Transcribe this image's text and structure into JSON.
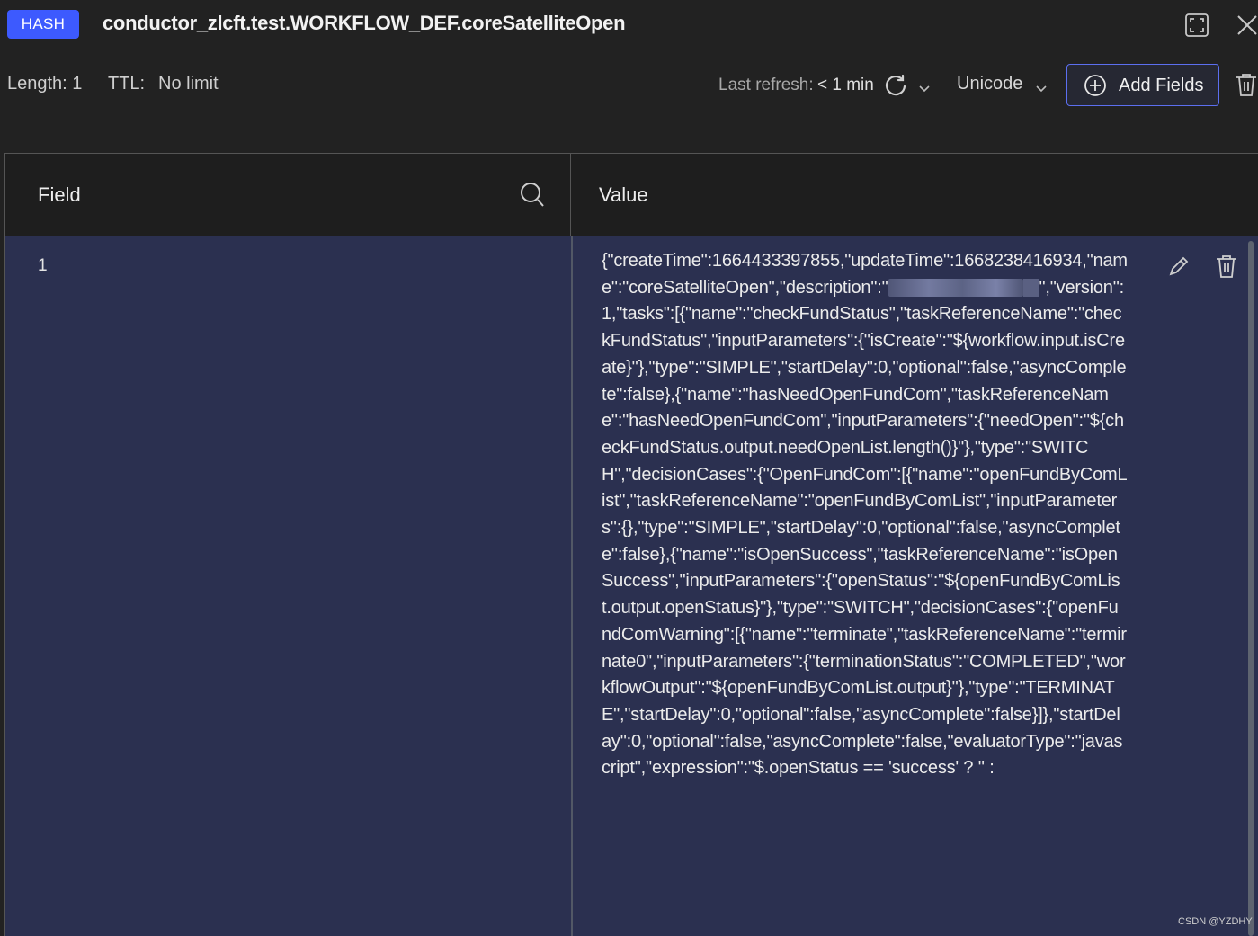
{
  "header": {
    "type_badge": "HASH",
    "key_name": "conductor_zlcft.test.WORKFLOW_DEF.coreSatelliteOpen",
    "length_label": "Length: 1",
    "ttl_label": "TTL:",
    "ttl_value": "No limit",
    "last_refresh_label": "Last refresh:",
    "last_refresh_value": "< 1 min",
    "encoding": "Unicode",
    "add_fields_label": "Add Fields"
  },
  "table": {
    "columns": [
      "Field",
      "Value"
    ],
    "rows": [
      {
        "field": "1",
        "value_part1": "{\"createTime\":1664433397855,\"updateTime\":1668238416934,\"name\":\"coreSatelliteOpen\",\"description\":\"",
        "value_part2": "\",\"version\":1,\"tasks\":[{\"name\":\"checkFundStatus\",\"taskReferenceName\":\"checkFundStatus\",\"inputParameters\":{\"isCreate\":\"${workflow.input.isCreate}\"},\"type\":\"SIMPLE\",\"startDelay\":0,\"optional\":false,\"asyncComplete\":false},{\"name\":\"hasNeedOpenFundCom\",\"taskReferenceName\":\"hasNeedOpenFundCom\",\"inputParameters\":{\"needOpen\":\"${checkFundStatus.output.needOpenList.length()}\"},\"type\":\"SWITCH\",\"decisionCases\":{\"OpenFundCom\":[{\"name\":\"openFundByComList\",\"taskReferenceName\":\"openFundByComList\",\"inputParameters\":{},\"type\":\"SIMPLE\",\"startDelay\":0,\"optional\":false,\"asyncComplete\":false},{\"name\":\"isOpenSuccess\",\"taskReferenceName\":\"isOpenSuccess\",\"inputParameters\":{\"openStatus\":\"${openFundByComList.output.openStatus}\"},\"type\":\"SWITCH\",\"decisionCases\":{\"openFundComWarning\":[{\"name\":\"terminate\",\"taskReferenceName\":\"termirnate0\",\"inputParameters\":{\"terminationStatus\":\"COMPLETED\",\"workflowOutput\":\"${openFundByComList.output}\"},\"type\":\"TERMINATE\",\"startDelay\":0,\"optional\":false,\"asyncComplete\":false}]},\"startDelay\":0,\"optional\":false,\"asyncComplete\":false,\"evaluatorType\":\"javascript\",\"expression\":\"$.openStatus == 'success' ? '' :"
      }
    ]
  },
  "watermark": "CSDN @YZDHY",
  "icons": {
    "expand": "expand-icon",
    "close": "close-icon",
    "refresh": "refresh-icon",
    "chevron": "chevron-down-icon",
    "add": "plus-circle-icon",
    "delete": "trash-icon",
    "search": "search-icon",
    "edit": "pencil-icon"
  },
  "colors": {
    "badge": "#3d5afe",
    "row_background": "#2b3050",
    "header_background": "#222222",
    "button_border": "#5c6ff0"
  }
}
